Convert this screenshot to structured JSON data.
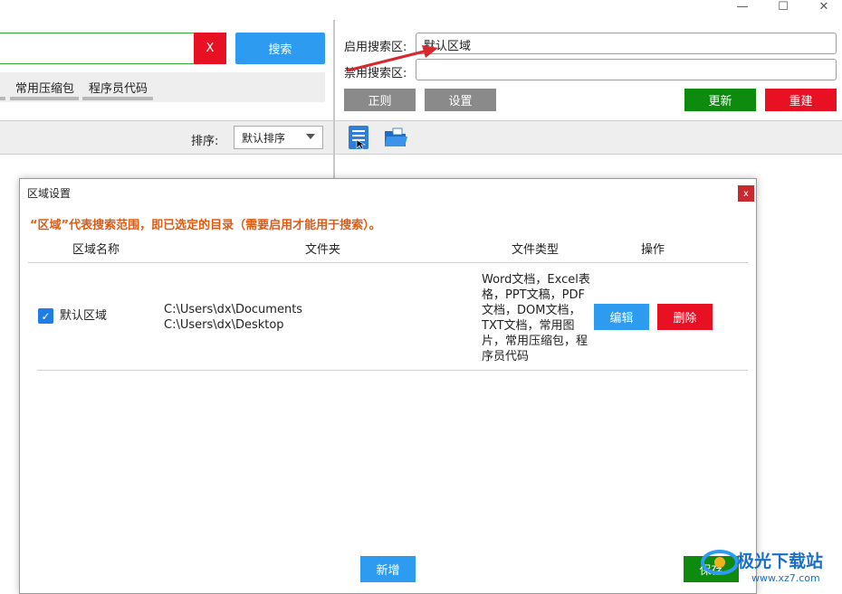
{
  "window": {
    "minimize_icon": "minimize-icon",
    "maximize_icon": "maximize-icon",
    "close_icon": "close-icon"
  },
  "search": {
    "value": "",
    "clear_label": "X",
    "search_label": "搜索"
  },
  "categories": [
    "常用压缩包",
    "程序员代码"
  ],
  "right": {
    "enabled_label": "启用搜索区:",
    "enabled_value": "默认区域",
    "disabled_label": "禁用搜索区:",
    "disabled_value": "",
    "regex_label": "正则",
    "settings_label": "设置",
    "update_label": "更新",
    "rebuild_label": "重建"
  },
  "toolbar": {
    "sort_label": "排序:",
    "sort_value": "默认排序"
  },
  "dialog": {
    "title": "区域设置",
    "close_label": "x",
    "note": "“区域”代表搜索范围，即已选定的目录（需要启用才能用于搜索）。",
    "columns": {
      "name": "区域名称",
      "folder": "文件夹",
      "types": "文件类型",
      "actions": "操作"
    },
    "rows": [
      {
        "checked": true,
        "name": "默认区域",
        "folders": [
          "C:\\Users\\dx\\Documents",
          "C:\\Users\\dx\\Desktop"
        ],
        "types_lines": [
          "Word文档，Excel表",
          "格，PPT文稿，PDF",
          "文档，DOM文档，",
          "TXT文档，常用图",
          "片，常用压缩包，程",
          "序员代码"
        ],
        "edit_label": "编辑",
        "delete_label": "删除"
      }
    ],
    "new_label": "新增",
    "save_label": "保存"
  },
  "watermark": {
    "text": "极光下载站",
    "url": "www.xz7.com"
  },
  "colors": {
    "blue": "#2d9cf0",
    "red": "#e81123",
    "green": "#0e8a0e",
    "orange": "#e05a12"
  }
}
